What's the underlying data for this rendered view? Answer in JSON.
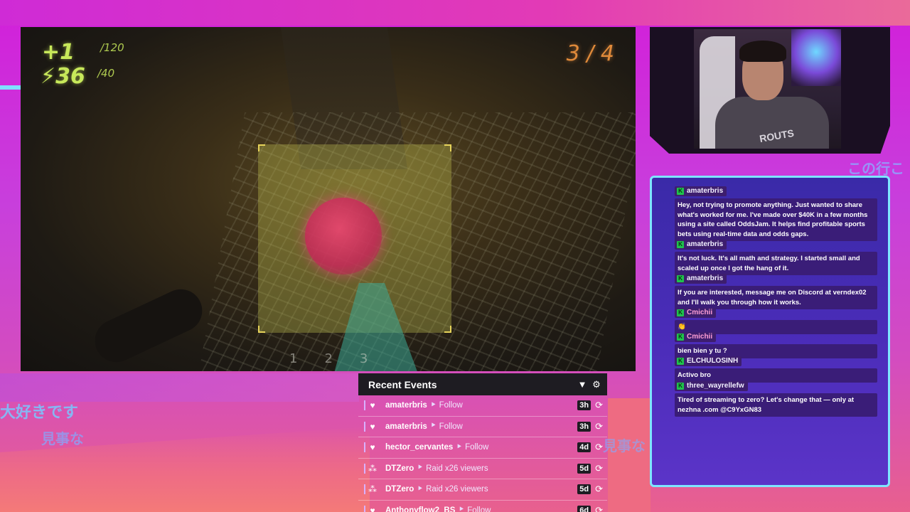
{
  "game": {
    "health_value": "+1",
    "health_max": "/120",
    "energy_value": "⚡36",
    "energy_max": "/40",
    "objective_count": "3 / 4",
    "weapon_slots": [
      "1",
      "2",
      "3"
    ]
  },
  "overlay_text": {
    "jp_left_top": "大好きです",
    "jp_left_bottom": "見事な",
    "jp_center": "見事な",
    "jp_right": "この行こ"
  },
  "webcam": {
    "shirt_text": "ROUTS"
  },
  "chat": {
    "messages": [
      {
        "user": "amaterbris",
        "text": "Hey, not trying to promote anything. Just wanted to share what's worked for me. I've made over $40K in a few months using a site called OddsJam. It helps find profitable sports bets using real-time data and odds gaps."
      },
      {
        "user": "amaterbris",
        "text": "It's not luck. It's all math and strategy. I started small and scaled up once I got the hang of it."
      },
      {
        "user": "amaterbris",
        "text": "If you are interested, message me on Discord at verndex02 and I'll walk you through how it works."
      },
      {
        "user": "Cmichii",
        "text": "👏"
      },
      {
        "user": "Cmichii",
        "text": "bien bien y tu ?"
      },
      {
        "user": "ELCHULOSINH",
        "text": "Activo bro"
      },
      {
        "user": "three_wayrellefw",
        "text": "Tired of streaming to zero? Let's change that — only at nezhna .com @C9YxGN83"
      }
    ]
  },
  "events": {
    "title": "Recent Events",
    "filter_icon": "▼",
    "settings_icon": "⚙",
    "items": [
      {
        "icon": "♥",
        "name": "amaterbris",
        "type": "Follow",
        "time": "3h"
      },
      {
        "icon": "♥",
        "name": "amaterbris",
        "type": "Follow",
        "time": "3h"
      },
      {
        "icon": "♥",
        "name": "hector_cervantes",
        "type": "Follow",
        "time": "4d"
      },
      {
        "icon": "⁂",
        "name": "DTZero",
        "type": "Raid x26 viewers",
        "time": "5d"
      },
      {
        "icon": "⁂",
        "name": "DTZero",
        "type": "Raid x26 viewers",
        "time": "5d"
      },
      {
        "icon": "♥",
        "name": "Anthonyflow2_BS",
        "type": "Follow",
        "time": "6d"
      }
    ],
    "arrow": "⯈",
    "replay_icon": "⟳"
  }
}
